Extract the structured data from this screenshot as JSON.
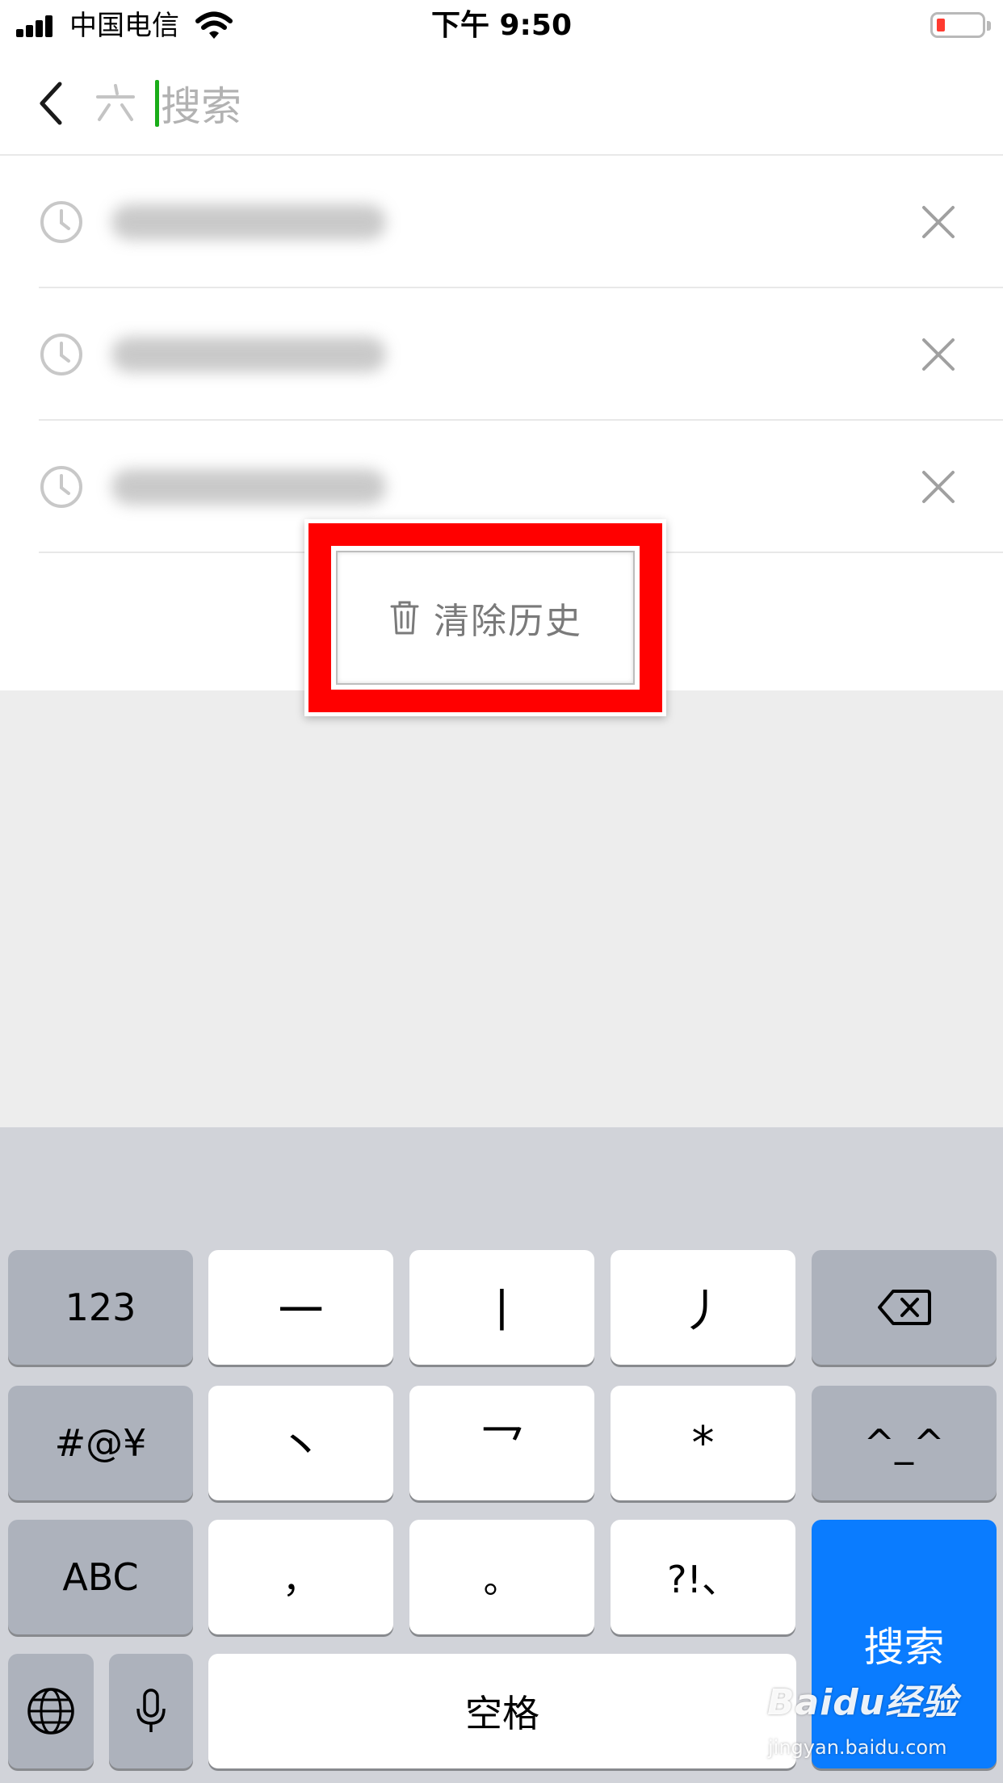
{
  "status_bar": {
    "carrier": "中国电信",
    "time": "下午 9:50",
    "battery_level": 0.1,
    "battery_color": "#ff3b30"
  },
  "header": {
    "back_icon": "chevron-left-icon",
    "search_type_icon": "stroke-input-icon",
    "search_placeholder": "搜索",
    "caret_color": "#1aad19"
  },
  "history": {
    "items": [
      {
        "text": "",
        "icon": "clock-icon",
        "remove_icon": "close-icon"
      },
      {
        "text": "",
        "icon": "clock-icon",
        "remove_icon": "close-icon"
      },
      {
        "text": "",
        "icon": "clock-icon",
        "remove_icon": "close-icon"
      }
    ],
    "clear_label": "清除历史",
    "clear_icon": "trash-icon",
    "highlight_color": "#ff0000"
  },
  "keyboard": {
    "row1": [
      "123",
      "一",
      "丨",
      "丿",
      "delete"
    ],
    "row2": [
      "#@¥",
      "丶",
      "乛",
      "*",
      "^_^"
    ],
    "row3": [
      "ABC",
      ",",
      "。",
      "?!、"
    ],
    "row4": [
      "globe",
      "mic",
      "空格"
    ],
    "key_123": "123",
    "key_heng": "一",
    "key_shu": "丨",
    "key_pie": "丿",
    "key_symbols": "#@¥",
    "key_dian": "丶",
    "key_zhe": "乛",
    "key_star": "*",
    "key_emoticon": "^_^",
    "key_abc": "ABC",
    "key_comma": "，",
    "key_period": "。",
    "key_punct": "?!、",
    "key_space": "空格",
    "key_search": "搜索",
    "search_key_color": "#0a7cff"
  },
  "watermark": {
    "logo": "Baidu经验",
    "url": "jingyan.baidu.com"
  }
}
